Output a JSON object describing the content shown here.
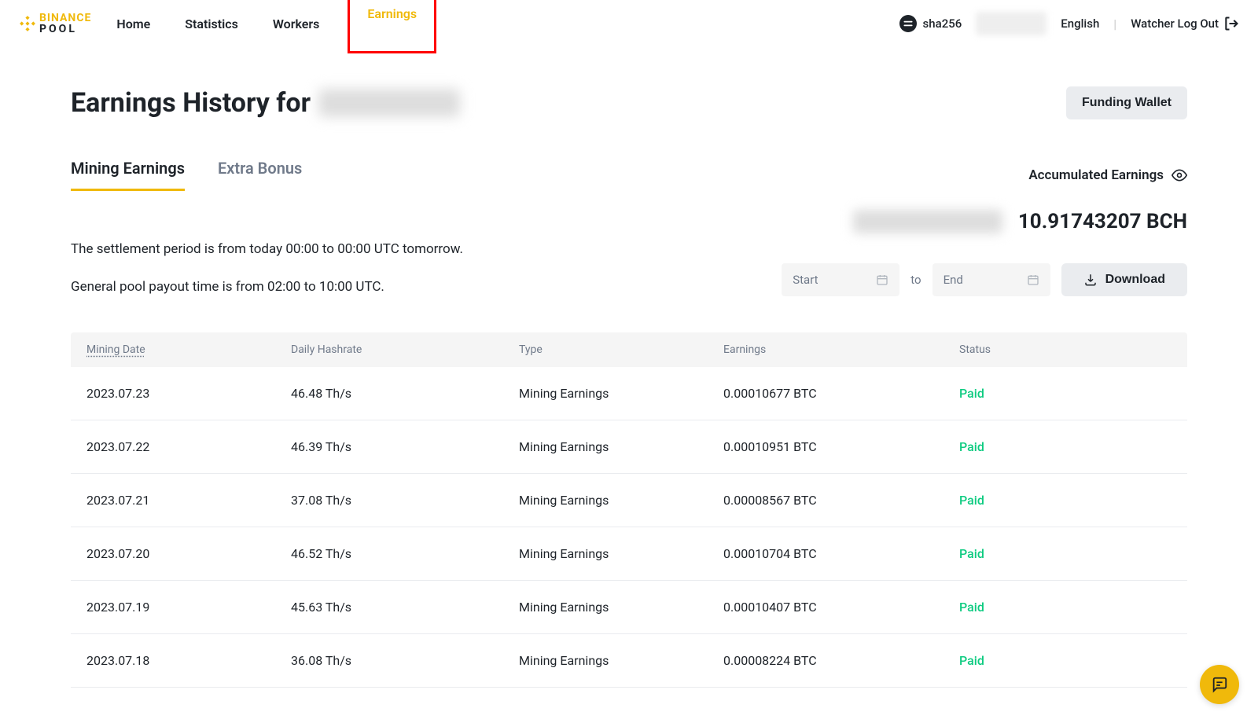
{
  "logo": {
    "top": "BINANCE",
    "bottom": "POOL"
  },
  "nav": {
    "home": "Home",
    "statistics": "Statistics",
    "workers": "Workers",
    "earnings": "Earnings"
  },
  "header": {
    "algo": "sha256",
    "language": "English",
    "logout": "Watcher Log Out"
  },
  "page": {
    "title_prefix": "Earnings History for",
    "funding_button": "Funding Wallet"
  },
  "tabs": {
    "mining": "Mining Earnings",
    "extra": "Extra Bonus"
  },
  "accumulated_label": "Accumulated Earnings",
  "balance_bch": "10.91743207 BCH",
  "info": {
    "settlement": "The settlement period is from today 00:00 to 00:00 UTC tomorrow.",
    "payout": "General pool payout time is from 02:00 to 10:00 UTC."
  },
  "controls": {
    "start_placeholder": "Start",
    "to": "to",
    "end_placeholder": "End",
    "download": "Download"
  },
  "columns": {
    "mining_date": "Mining Date",
    "daily_hashrate": "Daily Hashrate",
    "type": "Type",
    "earnings": "Earnings",
    "status": "Status"
  },
  "rows": [
    {
      "date": "2023.07.23",
      "hashrate": "46.48 Th/s",
      "type": "Mining Earnings",
      "earnings": "0.00010677 BTC",
      "status": "Paid"
    },
    {
      "date": "2023.07.22",
      "hashrate": "46.39 Th/s",
      "type": "Mining Earnings",
      "earnings": "0.00010951 BTC",
      "status": "Paid"
    },
    {
      "date": "2023.07.21",
      "hashrate": "37.08 Th/s",
      "type": "Mining Earnings",
      "earnings": "0.00008567 BTC",
      "status": "Paid"
    },
    {
      "date": "2023.07.20",
      "hashrate": "46.52 Th/s",
      "type": "Mining Earnings",
      "earnings": "0.00010704 BTC",
      "status": "Paid"
    },
    {
      "date": "2023.07.19",
      "hashrate": "45.63 Th/s",
      "type": "Mining Earnings",
      "earnings": "0.00010407 BTC",
      "status": "Paid"
    },
    {
      "date": "2023.07.18",
      "hashrate": "36.08 Th/s",
      "type": "Mining Earnings",
      "earnings": "0.00008224 BTC",
      "status": "Paid"
    }
  ]
}
